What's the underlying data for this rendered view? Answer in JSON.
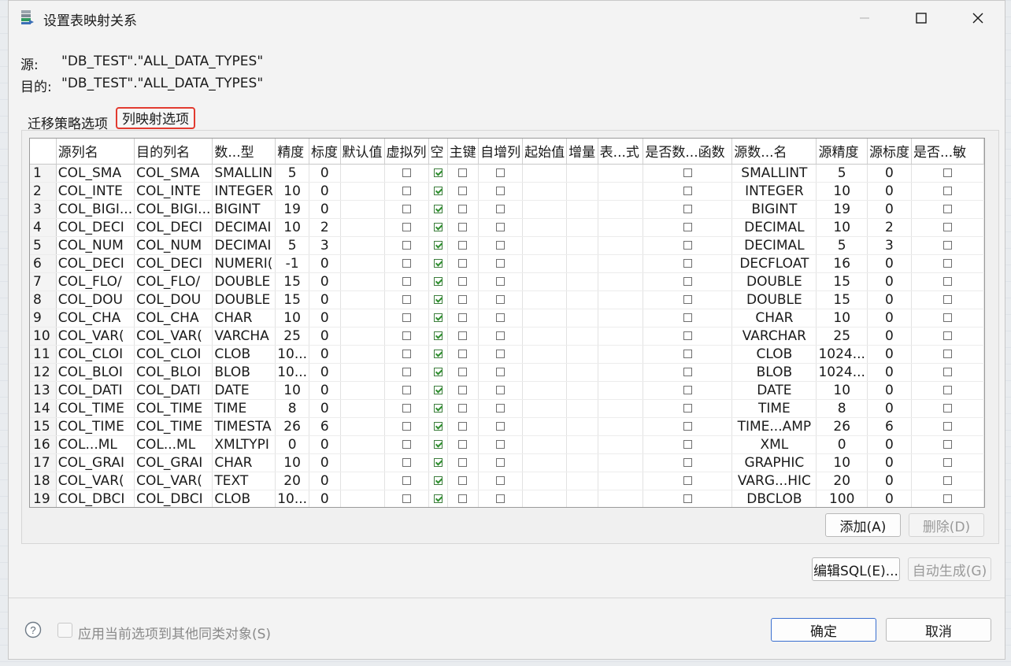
{
  "window": {
    "title": "设置表映射关系"
  },
  "info": {
    "source_label": "源:",
    "source_value": "\"DB_TEST\".\"ALL_DATA_TYPES\"",
    "target_label": "目的:",
    "target_value": "\"DB_TEST\".\"ALL_DATA_TYPES\""
  },
  "tabs": [
    {
      "label": "迁移策略选项",
      "active": false
    },
    {
      "label": "列映射选项",
      "active": true
    }
  ],
  "table": {
    "columns": [
      "",
      "源列名",
      "目的列名",
      "数...型",
      "精度",
      "标度",
      "默认值",
      "虚拟列",
      "空",
      "主键",
      "自增列",
      "起始值",
      "增量",
      "表...式",
      "是否数...函数",
      "源数...名",
      "源精度",
      "源标度",
      "是否...敏"
    ],
    "rows": [
      {
        "n": "1",
        "src": "COL_SMA",
        "dst": "COL_SMA",
        "type": "SMALLIN",
        "prec": "5",
        "scale": "0",
        "nullable": true,
        "src_type": "SMALLINT",
        "src_prec": "5",
        "src_scale": "0"
      },
      {
        "n": "2",
        "src": "COL_INTE",
        "dst": "COL_INTE",
        "type": "INTEGER",
        "prec": "10",
        "scale": "0",
        "nullable": true,
        "src_type": "INTEGER",
        "src_prec": "10",
        "src_scale": "0"
      },
      {
        "n": "3",
        "src": "COL_BIGI...",
        "dst": "COL_BIGI...",
        "type": "BIGINT",
        "prec": "19",
        "scale": "0",
        "nullable": true,
        "src_type": "BIGINT",
        "src_prec": "19",
        "src_scale": "0"
      },
      {
        "n": "4",
        "src": "COL_DECI",
        "dst": "COL_DECI",
        "type": "DECIMAI",
        "prec": "10",
        "scale": "2",
        "nullable": true,
        "src_type": "DECIMAL",
        "src_prec": "10",
        "src_scale": "2"
      },
      {
        "n": "5",
        "src": "COL_NUM",
        "dst": "COL_NUM",
        "type": "DECIMAI",
        "prec": "5",
        "scale": "3",
        "nullable": true,
        "src_type": "DECIMAL",
        "src_prec": "5",
        "src_scale": "3"
      },
      {
        "n": "6",
        "src": "COL_DECI",
        "dst": "COL_DECI",
        "type": "NUMERI(",
        "prec": "-1",
        "scale": "0",
        "nullable": true,
        "src_type": "DECFLOAT",
        "src_prec": "16",
        "src_scale": "0"
      },
      {
        "n": "7",
        "src": "COL_FLO/",
        "dst": "COL_FLO/",
        "type": "DOUBLE",
        "prec": "15",
        "scale": "0",
        "nullable": true,
        "src_type": "DOUBLE",
        "src_prec": "15",
        "src_scale": "0"
      },
      {
        "n": "8",
        "src": "COL_DOU",
        "dst": "COL_DOU",
        "type": "DOUBLE",
        "prec": "15",
        "scale": "0",
        "nullable": true,
        "src_type": "DOUBLE",
        "src_prec": "15",
        "src_scale": "0"
      },
      {
        "n": "9",
        "src": "COL_CHA",
        "dst": "COL_CHA",
        "type": "CHAR",
        "prec": "10",
        "scale": "0",
        "nullable": true,
        "src_type": "CHAR",
        "src_prec": "10",
        "src_scale": "0"
      },
      {
        "n": "10",
        "src": "COL_VAR(",
        "dst": "COL_VAR(",
        "type": "VARCHA",
        "prec": "25",
        "scale": "0",
        "nullable": true,
        "src_type": "VARCHAR",
        "src_prec": "25",
        "src_scale": "0"
      },
      {
        "n": "11",
        "src": "COL_CLOI",
        "dst": "COL_CLOI",
        "type": "CLOB",
        "prec": "10...",
        "scale": "0",
        "nullable": true,
        "src_type": "CLOB",
        "src_prec": "1024...",
        "src_scale": "0"
      },
      {
        "n": "12",
        "src": "COL_BLOI",
        "dst": "COL_BLOI",
        "type": "BLOB",
        "prec": "10...",
        "scale": "0",
        "nullable": true,
        "src_type": "BLOB",
        "src_prec": "1024...",
        "src_scale": "0"
      },
      {
        "n": "13",
        "src": "COL_DATI",
        "dst": "COL_DATI",
        "type": "DATE",
        "prec": "10",
        "scale": "0",
        "nullable": true,
        "src_type": "DATE",
        "src_prec": "10",
        "src_scale": "0"
      },
      {
        "n": "14",
        "src": "COL_TIME",
        "dst": "COL_TIME",
        "type": "TIME",
        "prec": "8",
        "scale": "0",
        "nullable": true,
        "src_type": "TIME",
        "src_prec": "8",
        "src_scale": "0"
      },
      {
        "n": "15",
        "src": "COL_TIME",
        "dst": "COL_TIME",
        "type": "TIMESTA",
        "prec": "26",
        "scale": "6",
        "nullable": true,
        "src_type": "TIME...AMP",
        "src_prec": "26",
        "src_scale": "6"
      },
      {
        "n": "16",
        "src": "COL...ML",
        "dst": "COL...ML",
        "type": "XMLTYPI",
        "prec": "0",
        "scale": "0",
        "nullable": true,
        "src_type": "XML",
        "src_prec": "0",
        "src_scale": "0"
      },
      {
        "n": "17",
        "src": "COL_GRAI",
        "dst": "COL_GRAI",
        "type": "CHAR",
        "prec": "10",
        "scale": "0",
        "nullable": true,
        "src_type": "GRAPHIC",
        "src_prec": "10",
        "src_scale": "0"
      },
      {
        "n": "18",
        "src": "COL_VAR(",
        "dst": "COL_VAR(",
        "type": "TEXT",
        "prec": "20",
        "scale": "0",
        "nullable": true,
        "src_type": "VARG...HIC",
        "src_prec": "20",
        "src_scale": "0"
      },
      {
        "n": "19",
        "src": "COL_DBCI",
        "dst": "COL_DBCI",
        "type": "CLOB",
        "prec": "10...",
        "scale": "0",
        "nullable": true,
        "src_type": "DBCLOB",
        "src_prec": "100",
        "src_scale": "0"
      }
    ]
  },
  "buttons": {
    "add": "添加(A)",
    "delete": "删除(D)",
    "edit_sql": "编辑SQL(E)...",
    "auto_generate": "自动生成(G)",
    "ok": "确定",
    "cancel": "取消"
  },
  "footer": {
    "apply_label": "应用当前选项到其他同类对象(S)"
  },
  "colors": {
    "accent": "#3a6fd0",
    "tab_highlight": "#e23b30",
    "check": "#2f8f2f"
  }
}
